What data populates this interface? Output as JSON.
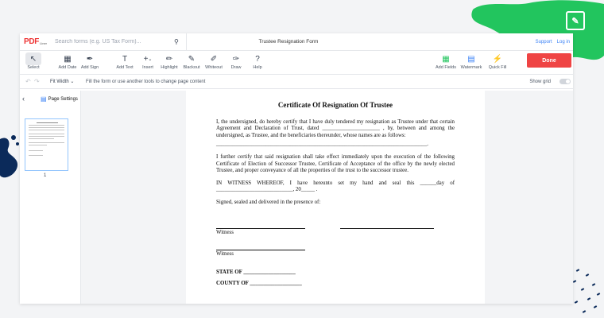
{
  "colors": {
    "brand_red": "#ef4444",
    "deco_green": "#22c55e",
    "deco_navy": "#0b2a5a"
  },
  "topbar": {
    "logo_text": "PDF",
    "logo_sub": "Liner",
    "search_placeholder": "Search forms (e.g. US Tax Form)...",
    "document_title": "Trustee Resignation Form",
    "support": "Support",
    "login": "Log in"
  },
  "toolbar": {
    "select": "Select",
    "add_date": "Add Date",
    "add_sign": "Add Sign",
    "add_text": "Add Text",
    "insert": "Insert",
    "highlight": "Highlight",
    "blackout": "Blackout",
    "whiteout": "Whiteout",
    "draw": "Draw",
    "help": "Help",
    "add_fields": "Add Fields",
    "watermark": "Watermark",
    "quick_fill": "Quick Fill",
    "done": "Done"
  },
  "subbar": {
    "zoom": "Fit Width",
    "hint": "Fill the form or use another tools to change page content",
    "show_grid": "Show grid"
  },
  "sidebar": {
    "page_settings": "Page Settings",
    "page_number": "1"
  },
  "document": {
    "title": "Certificate Of Resignation Of Trustee",
    "para1": "I, the undersigned, do hereby certify that I have duly tendered my resignation as Trustee under that certain Agreement and Declaration of Trust, dated _____________________ , by, between and among the undersigned, as Trustee, and the beneficiaries thereunder, whose names are as follows:",
    "line1": "_____________________________________________________________________________.",
    "para2": "I further certify that said resignation shall take effect immediately upon the execution of the following Certificate of Election of Successor Trustee, Certificate of Acceptance of the office by the newly elected Trustee, and proper conveyance of all the properties of the trust to the successor trustee.",
    "para3": "IN WITNESS WHEREOF, I have hereunto set my hand and seal this ______day of ____________________________, 20_____ .",
    "para4": "Signed, sealed and delivered in the presence of:",
    "witness1": "Witness",
    "witness2": "Witness",
    "state": "STATE OF ___________________",
    "county": "COUNTY OF ___________________"
  }
}
